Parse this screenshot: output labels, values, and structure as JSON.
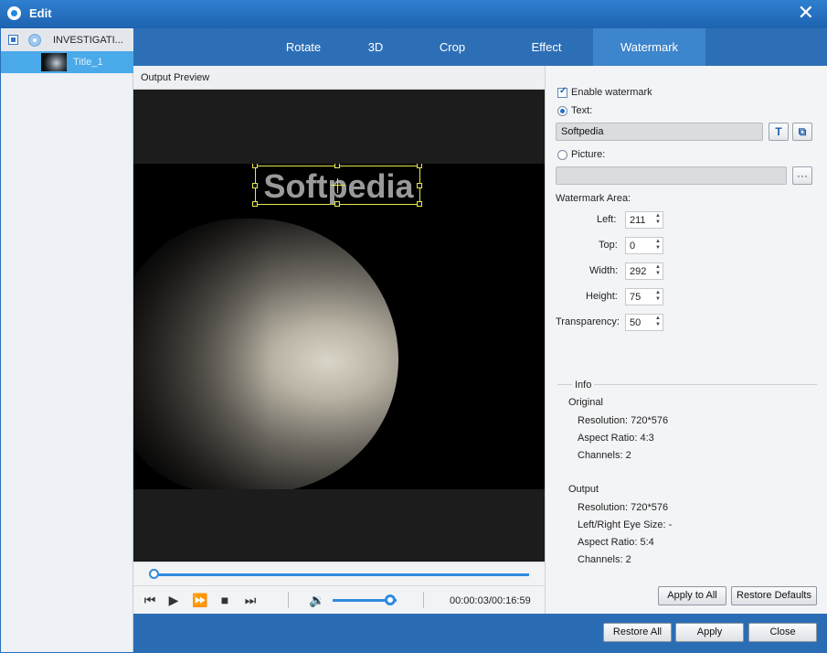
{
  "window": {
    "title": "Edit",
    "close_icon": "close-icon"
  },
  "sidebar": {
    "parent_label": "INVESTIGATI...",
    "child_label": "Title_1"
  },
  "tabs": [
    {
      "label": "Rotate"
    },
    {
      "label": "3D"
    },
    {
      "label": "Crop"
    },
    {
      "label": "Effect"
    },
    {
      "label": "Watermark",
      "active": true
    }
  ],
  "preview": {
    "header": "Output Preview",
    "watermark_text": "Softpedia",
    "timecode": "00:00:03/00:16:59",
    "seek_progress": 0.01,
    "volume_level": 0.9
  },
  "watermark": {
    "enable_label": "Enable watermark",
    "enabled": true,
    "text_option_label": "Text:",
    "text_value": "Softpedia",
    "picture_option_label": "Picture:",
    "picture_path": "",
    "browse_label": "···",
    "area_label": "Watermark Area:",
    "fields": {
      "left_label": "Left:",
      "left": "211",
      "top_label": "Top:",
      "top": "0",
      "width_label": "Width:",
      "width": "292",
      "height_label": "Height:",
      "height": "75",
      "transparency_label": "Transparency:",
      "transparency": "50"
    }
  },
  "info": {
    "title": "Info",
    "original_label": "Original",
    "original": {
      "resolution": "Resolution: 720*576",
      "aspect": "Aspect Ratio: 4:3",
      "channels": "Channels: 2"
    },
    "output_label": "Output",
    "output": {
      "resolution": "Resolution: 720*576",
      "eye_size": "Left/Right Eye Size: -",
      "aspect": "Aspect Ratio: 5:4",
      "channels": "Channels: 2"
    }
  },
  "buttons": {
    "apply_to_all": "Apply to All",
    "restore_defaults": "Restore Defaults",
    "restore_all": "Restore All",
    "apply": "Apply",
    "close": "Close"
  },
  "colors": {
    "accent": "#2d6fb6",
    "tab_active": "#3d85cc",
    "selection": "#4aa9e8",
    "watermark_frame": "#e8e84a"
  }
}
